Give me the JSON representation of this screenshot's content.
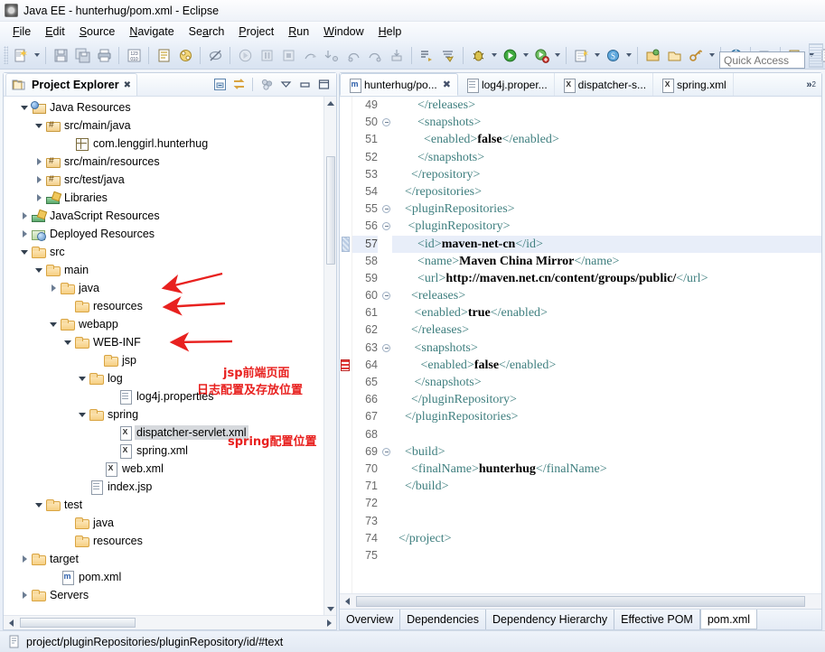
{
  "window": {
    "title": "Java EE - hunterhug/pom.xml - Eclipse",
    "icon": "eclipse-app-icon"
  },
  "menubar": {
    "items": [
      {
        "label": "File",
        "mnemonic": "F"
      },
      {
        "label": "Edit",
        "mnemonic": "E"
      },
      {
        "label": "Source",
        "mnemonic": "S"
      },
      {
        "label": "Navigate",
        "mnemonic": "N"
      },
      {
        "label": "Search",
        "mnemonic": "a"
      },
      {
        "label": "Project",
        "mnemonic": "P"
      },
      {
        "label": "Run",
        "mnemonic": "R"
      },
      {
        "label": "Window",
        "mnemonic": "W"
      },
      {
        "label": "Help",
        "mnemonic": "H"
      }
    ]
  },
  "toolbar": {
    "quick_access_placeholder": "Quick Access",
    "groups": [
      {
        "buttons": [
          {
            "name": "new-wizard-icon",
            "glyph": "new"
          },
          {
            "name": "new-dropdown-arrow",
            "glyph": "arrow"
          }
        ]
      },
      {
        "buttons": [
          {
            "name": "save-icon",
            "glyph": "save"
          },
          {
            "name": "save-all-icon",
            "glyph": "saveall"
          },
          {
            "name": "print-icon",
            "glyph": "print"
          }
        ]
      },
      {
        "buttons": [
          {
            "name": "toggle-numbers-icon",
            "glyph": "numbers"
          }
        ]
      },
      {
        "buttons": [
          {
            "name": "new-jsp-icon",
            "glyph": "jsp"
          },
          {
            "name": "new-servlet-icon",
            "glyph": "servlet"
          }
        ]
      },
      {
        "buttons": [
          {
            "name": "no-markers-icon",
            "glyph": "nomarker"
          }
        ]
      },
      {
        "buttons": [
          {
            "name": "start-server-icon",
            "glyph": "play-gray"
          },
          {
            "name": "pause-icon",
            "glyph": "pause-gray"
          },
          {
            "name": "stop-icon",
            "glyph": "stop-gray"
          },
          {
            "name": "step-icon",
            "glyph": "step-gray"
          }
        ]
      },
      {
        "buttons": [
          {
            "name": "step-into-icon",
            "glyph": "stepinto"
          },
          {
            "name": "step-over-icon",
            "glyph": "stepover"
          },
          {
            "name": "step-return-icon",
            "glyph": "stepreturn"
          },
          {
            "name": "drop-to-frame-icon",
            "glyph": "dropframe"
          }
        ]
      },
      {
        "buttons": [
          {
            "name": "open-type-icon",
            "glyph": "opentype"
          },
          {
            "name": "search-icon",
            "glyph": "searchtool"
          }
        ]
      },
      {
        "buttons": [
          {
            "name": "debug-icon",
            "glyph": "bug"
          },
          {
            "name": "debug-dropdown-arrow",
            "glyph": "arrow"
          },
          {
            "name": "run-icon",
            "glyph": "run-green"
          },
          {
            "name": "run-dropdown-arrow",
            "glyph": "arrow"
          },
          {
            "name": "run-external-icon",
            "glyph": "run-ext"
          },
          {
            "name": "run-external-dropdown-arrow",
            "glyph": "arrow"
          }
        ]
      },
      {
        "buttons": [
          {
            "name": "new-java-project-icon",
            "glyph": "newproj"
          },
          {
            "name": "new-java-dropdown-arrow",
            "glyph": "arrow"
          },
          {
            "name": "new-annotation-icon",
            "glyph": "annot"
          },
          {
            "name": "new-annotation-dropdown-arrow",
            "glyph": "arrow"
          },
          {
            "name": "new-class-icon",
            "glyph": "newclass"
          },
          {
            "name": "new-class-dropdown-arrow",
            "glyph": "arrow"
          }
        ]
      },
      {
        "buttons": [
          {
            "name": "open-perspective-icon",
            "glyph": "persp"
          },
          {
            "name": "open-folder-icon",
            "glyph": "openfolder"
          },
          {
            "name": "key-icon",
            "glyph": "key"
          },
          {
            "name": "key-dropdown-arrow",
            "glyph": "arrow"
          }
        ]
      },
      {
        "buttons": [
          {
            "name": "web-browser-icon",
            "glyph": "globe"
          }
        ]
      },
      {
        "buttons": [
          {
            "name": "run-on-server-icon",
            "glyph": "runserver"
          }
        ]
      },
      {
        "buttons": [
          {
            "name": "deploy-icon",
            "glyph": "deploy"
          },
          {
            "name": "deploy-dropdown-arrow",
            "glyph": "arrow"
          },
          {
            "name": "new-page-icon",
            "glyph": "newpage"
          },
          {
            "name": "new-page-dropdown-arrow",
            "glyph": "arrow"
          },
          {
            "name": "import-icon",
            "glyph": "import"
          }
        ]
      }
    ]
  },
  "explorer": {
    "title": "Project Explorer",
    "close_glyph": "✖",
    "tools": [
      {
        "name": "collapse-all-icon"
      },
      {
        "name": "link-with-editor-icon"
      },
      {
        "name": "view-menu-icon"
      },
      {
        "name": "view-dropdown-icon"
      },
      {
        "name": "minimize-view-icon"
      },
      {
        "name": "maximize-view-icon"
      }
    ],
    "tree": [
      {
        "label": "Java Resources",
        "indent": 1,
        "twist": "open",
        "icon": "java-resources-icon"
      },
      {
        "label": "src/main/java",
        "indent": 2,
        "twist": "open",
        "icon": "source-folder-icon"
      },
      {
        "label": "com.lenggirl.hunterhug",
        "indent": 4,
        "twist": "none",
        "icon": "package-icon"
      },
      {
        "label": "src/main/resources",
        "indent": 2,
        "twist": "closed",
        "icon": "source-folder-icon"
      },
      {
        "label": "src/test/java",
        "indent": 2,
        "twist": "closed",
        "icon": "source-folder-icon"
      },
      {
        "label": "Libraries",
        "indent": 2,
        "twist": "closed",
        "icon": "libraries-icon"
      },
      {
        "label": "JavaScript Resources",
        "indent": 1,
        "twist": "closed",
        "icon": "libraries-icon"
      },
      {
        "label": "Deployed Resources",
        "indent": 1,
        "twist": "closed",
        "icon": "deployed-resources-icon"
      },
      {
        "label": "src",
        "indent": 1,
        "twist": "open",
        "icon": "folder-icon"
      },
      {
        "label": "main",
        "indent": 2,
        "twist": "open",
        "icon": "folder-icon"
      },
      {
        "label": "java",
        "indent": 3,
        "twist": "closed",
        "icon": "folder-icon"
      },
      {
        "label": "resources",
        "indent": 4,
        "twist": "none",
        "icon": "folder-icon"
      },
      {
        "label": "webapp",
        "indent": 3,
        "twist": "open",
        "icon": "folder-icon"
      },
      {
        "label": "WEB-INF",
        "indent": 4,
        "twist": "open",
        "icon": "folder-icon"
      },
      {
        "label": "jsp",
        "indent": 6,
        "twist": "none",
        "icon": "folder-icon"
      },
      {
        "label": "log",
        "indent": 5,
        "twist": "open",
        "icon": "folder-icon"
      },
      {
        "label": "log4j.properties",
        "indent": 7,
        "twist": "none",
        "icon": "properties-file-icon"
      },
      {
        "label": "spring",
        "indent": 5,
        "twist": "open",
        "icon": "folder-icon"
      },
      {
        "label": "dispatcher-servlet.xml",
        "indent": 7,
        "twist": "none",
        "icon": "xml-file-icon",
        "selected": true
      },
      {
        "label": "spring.xml",
        "indent": 7,
        "twist": "none",
        "icon": "xml-file-icon"
      },
      {
        "label": "web.xml",
        "indent": 6,
        "twist": "none",
        "icon": "xml-file-icon"
      },
      {
        "label": "index.jsp",
        "indent": 5,
        "twist": "none",
        "icon": "jsp-file-icon"
      },
      {
        "label": "test",
        "indent": 2,
        "twist": "open",
        "icon": "folder-icon"
      },
      {
        "label": "java",
        "indent": 4,
        "twist": "none",
        "icon": "folder-icon"
      },
      {
        "label": "resources",
        "indent": 4,
        "twist": "none",
        "icon": "folder-icon"
      },
      {
        "label": "target",
        "indent": 1,
        "twist": "closed",
        "icon": "folder-icon"
      },
      {
        "label": "pom.xml",
        "indent": 3,
        "twist": "none",
        "icon": "maven-pom-icon"
      },
      {
        "label": "Servers",
        "indent": 1,
        "twist": "closed",
        "icon": "folder-icon"
      }
    ],
    "annotations": [
      {
        "text": "jsp前端页面",
        "target": "jsp"
      },
      {
        "text": "日志配置及存放位置",
        "target": "log"
      },
      {
        "text": "spring配置位置",
        "target": "spring"
      }
    ]
  },
  "editor": {
    "tabs": [
      {
        "label": "hunterhug/po...",
        "icon": "maven-pom-icon",
        "active": true,
        "closable": true
      },
      {
        "label": "log4j.proper...",
        "icon": "properties-file-icon",
        "active": false,
        "closable": false
      },
      {
        "label": "dispatcher-s...",
        "icon": "xml-file-icon",
        "active": false,
        "closable": false
      },
      {
        "label": "spring.xml",
        "icon": "xml-file-icon",
        "active": false,
        "closable": false
      }
    ],
    "overflow_label": "»",
    "overflow_count": "2",
    "lines": [
      {
        "num": "49",
        "fold": false,
        "marker": "none",
        "indent": 8,
        "parts": [
          {
            "t": "tag",
            "v": "</releases>"
          }
        ]
      },
      {
        "num": "50",
        "fold": true,
        "marker": "none",
        "indent": 8,
        "parts": [
          {
            "t": "tag",
            "v": "<snapshots>"
          }
        ]
      },
      {
        "num": "51",
        "fold": false,
        "marker": "none",
        "indent": 10,
        "parts": [
          {
            "t": "tag",
            "v": "<enabled>"
          },
          {
            "t": "txt",
            "v": "false"
          },
          {
            "t": "tag",
            "v": "</enabled>"
          }
        ]
      },
      {
        "num": "52",
        "fold": false,
        "marker": "none",
        "indent": 8,
        "parts": [
          {
            "t": "tag",
            "v": "</snapshots>"
          }
        ]
      },
      {
        "num": "53",
        "fold": false,
        "marker": "none",
        "indent": 6,
        "parts": [
          {
            "t": "tag",
            "v": "</repository>"
          }
        ]
      },
      {
        "num": "54",
        "fold": false,
        "marker": "none",
        "indent": 4,
        "parts": [
          {
            "t": "tag",
            "v": "</repositories>"
          }
        ]
      },
      {
        "num": "55",
        "fold": true,
        "marker": "none",
        "indent": 4,
        "parts": [
          {
            "t": "tag",
            "v": "<pluginRepositories>"
          }
        ]
      },
      {
        "num": "56",
        "fold": true,
        "marker": "none",
        "indent": 5,
        "parts": [
          {
            "t": "tag",
            "v": "<pluginRepository>"
          }
        ]
      },
      {
        "num": "57",
        "fold": false,
        "marker": "cursor",
        "indent": 8,
        "highlight": true,
        "parts": [
          {
            "t": "tag",
            "v": "<id>"
          },
          {
            "t": "txt",
            "v": "maven-net-cn"
          },
          {
            "t": "tag",
            "v": "</id>"
          }
        ]
      },
      {
        "num": "58",
        "fold": false,
        "marker": "none",
        "indent": 8,
        "parts": [
          {
            "t": "tag",
            "v": "<name>"
          },
          {
            "t": "txt",
            "v": "Maven China Mirror"
          },
          {
            "t": "tag",
            "v": "</name>"
          }
        ]
      },
      {
        "num": "59",
        "fold": false,
        "marker": "none",
        "indent": 8,
        "parts": [
          {
            "t": "tag",
            "v": "<url>"
          },
          {
            "t": "txt",
            "v": "http://maven.net.cn/content/groups/public/"
          },
          {
            "t": "tag",
            "v": "</url>"
          }
        ]
      },
      {
        "num": "60",
        "fold": true,
        "marker": "none",
        "indent": 6,
        "parts": [
          {
            "t": "tag",
            "v": "<releases>"
          }
        ]
      },
      {
        "num": "61",
        "fold": false,
        "marker": "none",
        "indent": 7,
        "parts": [
          {
            "t": "tag",
            "v": "<enabled>"
          },
          {
            "t": "txt",
            "v": "true"
          },
          {
            "t": "tag",
            "v": "</enabled>"
          }
        ]
      },
      {
        "num": "62",
        "fold": false,
        "marker": "none",
        "indent": 6,
        "parts": [
          {
            "t": "tag",
            "v": "</releases>"
          }
        ]
      },
      {
        "num": "63",
        "fold": true,
        "marker": "none",
        "indent": 7,
        "parts": [
          {
            "t": "tag",
            "v": "<snapshots>"
          }
        ]
      },
      {
        "num": "64",
        "fold": false,
        "marker": "red",
        "indent": 9,
        "parts": [
          {
            "t": "tag",
            "v": "<enabled>"
          },
          {
            "t": "txt",
            "v": "false"
          },
          {
            "t": "tag",
            "v": "</enabled>"
          }
        ]
      },
      {
        "num": "65",
        "fold": false,
        "marker": "none",
        "indent": 7,
        "parts": [
          {
            "t": "tag",
            "v": "</snapshots>"
          }
        ]
      },
      {
        "num": "66",
        "fold": false,
        "marker": "none",
        "indent": 6,
        "parts": [
          {
            "t": "tag",
            "v": "</pluginRepository>"
          }
        ]
      },
      {
        "num": "67",
        "fold": false,
        "marker": "none",
        "indent": 4,
        "parts": [
          {
            "t": "tag",
            "v": "</pluginRepositories>"
          }
        ]
      },
      {
        "num": "68",
        "fold": false,
        "marker": "none",
        "indent": 0,
        "parts": []
      },
      {
        "num": "69",
        "fold": true,
        "marker": "none",
        "indent": 4,
        "parts": [
          {
            "t": "tag",
            "v": "<build>"
          }
        ]
      },
      {
        "num": "70",
        "fold": false,
        "marker": "none",
        "indent": 6,
        "parts": [
          {
            "t": "tag",
            "v": "<finalName>"
          },
          {
            "t": "txt",
            "v": "hunterhug"
          },
          {
            "t": "tag",
            "v": "</finalName>"
          }
        ]
      },
      {
        "num": "71",
        "fold": false,
        "marker": "none",
        "indent": 4,
        "parts": [
          {
            "t": "tag",
            "v": "</build>"
          }
        ]
      },
      {
        "num": "72",
        "fold": false,
        "marker": "none",
        "indent": 0,
        "parts": []
      },
      {
        "num": "73",
        "fold": false,
        "marker": "none",
        "indent": 0,
        "parts": []
      },
      {
        "num": "74",
        "fold": false,
        "marker": "none",
        "indent": 2,
        "parts": [
          {
            "t": "tag",
            "v": "</project>"
          }
        ]
      },
      {
        "num": "75",
        "fold": false,
        "marker": "none",
        "indent": 0,
        "parts": []
      }
    ],
    "form_tabs": [
      {
        "label": "Overview",
        "active": false
      },
      {
        "label": "Dependencies",
        "active": false
      },
      {
        "label": "Dependency Hierarchy",
        "active": false
      },
      {
        "label": "Effective POM",
        "active": false
      },
      {
        "label": "pom.xml",
        "active": true
      }
    ]
  },
  "statusbar": {
    "icon": "xml-node-icon",
    "path": "project/pluginRepositories/pluginRepository/id/#text"
  },
  "colors": {
    "xml_tag": "#3f7f7f",
    "xml_text": "#000000",
    "annotation_red": "#e8211f",
    "selection_blue": "#e8eef9",
    "chrome": "#dfe8f4"
  }
}
